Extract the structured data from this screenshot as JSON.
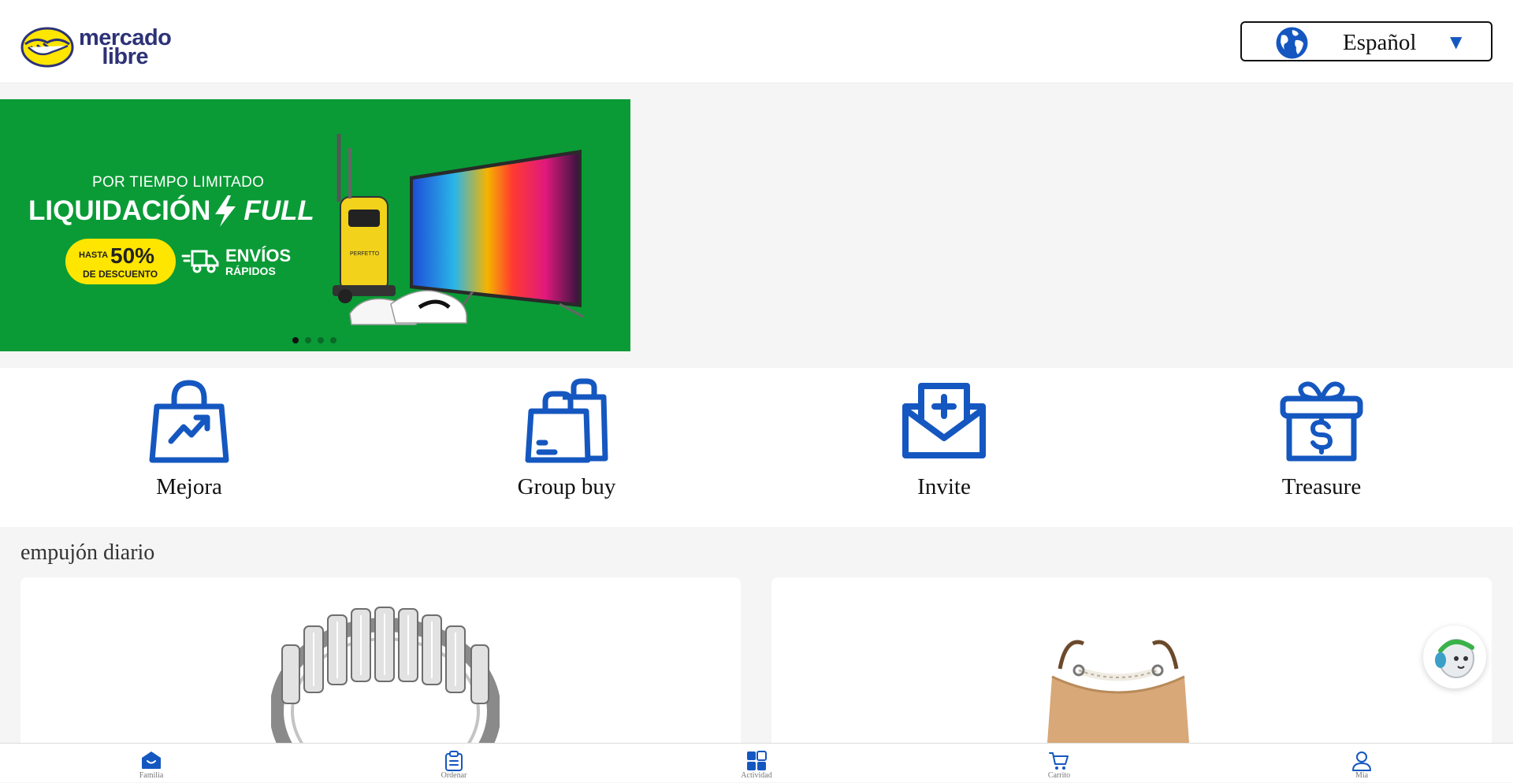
{
  "header": {
    "logo_line1": "mercado",
    "logo_line2": "libre",
    "language": "Español"
  },
  "banner": {
    "subtitle": "POR TIEMPO LIMITADO",
    "title": "LIQUIDACIÓN",
    "title_brand": "FULL",
    "discount_prefix": "HASTA",
    "discount_value": "50%",
    "discount_suffix": "DE DESCUENTO",
    "shipping_line1": "ENVÍOS",
    "shipping_line2": "RÁPIDOS",
    "product_brand": "PERFETTO",
    "slides": 4,
    "active_slide": 1
  },
  "shortcuts": [
    {
      "label": "Mejora",
      "icon": "trending-bag-icon"
    },
    {
      "label": "Group buy",
      "icon": "shopping-bags-icon"
    },
    {
      "label": "Invite",
      "icon": "mail-plus-icon"
    },
    {
      "label": "Treasure",
      "icon": "gift-dollar-icon"
    }
  ],
  "section": {
    "title": "empujón diario"
  },
  "products": [
    {
      "image": "diamond-ring"
    },
    {
      "image": "tan-handbag"
    }
  ],
  "bottom_nav": [
    {
      "label": "Familia",
      "icon": "home-icon",
      "active": true
    },
    {
      "label": "Ordenar",
      "icon": "clipboard-icon",
      "active": false
    },
    {
      "label": "Actividad",
      "icon": "grid-icon",
      "active": false
    },
    {
      "label": "Carrito",
      "icon": "cart-icon",
      "active": false
    },
    {
      "label": "Mia",
      "icon": "user-icon",
      "active": false
    }
  ],
  "colors": {
    "accent": "#1557c0",
    "banner_green": "#0a9b36",
    "brand_yellow": "#ffe600",
    "brand_navy": "#2d3277"
  }
}
